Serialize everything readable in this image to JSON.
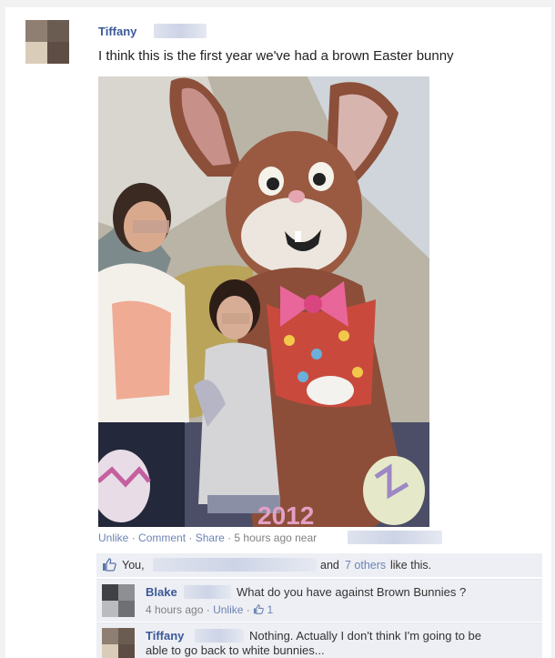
{
  "post": {
    "author": "Tiffany",
    "text": "I think this is the first year we've had a brown Easter bunny",
    "photo_year_partial": "2012"
  },
  "actions": {
    "unlike": "Unlike",
    "sep1": " · ",
    "comment": "Comment",
    "sep2": " · ",
    "share": "Share",
    "sep3": " · ",
    "time": "5 hours ago near"
  },
  "likes": {
    "you": "You,",
    "and": "and",
    "others": "7 others",
    "suffix": "like this."
  },
  "comments": [
    {
      "author": "Blake",
      "text": "What do you have against Brown Bunnies ?",
      "time": "4 hours ago",
      "unlike": "Unlike",
      "like_count": "1"
    },
    {
      "author": "Tiffany",
      "text_line1": "Nothing. Actually I don't think I'm going to be",
      "text_line2": "able to go back to white bunnies..."
    }
  ],
  "colors": {
    "link": "#3b5998",
    "muted_link": "#6d84b4",
    "comment_bg": "#edeff4"
  },
  "icons": [
    "like-thumb-icon"
  ]
}
